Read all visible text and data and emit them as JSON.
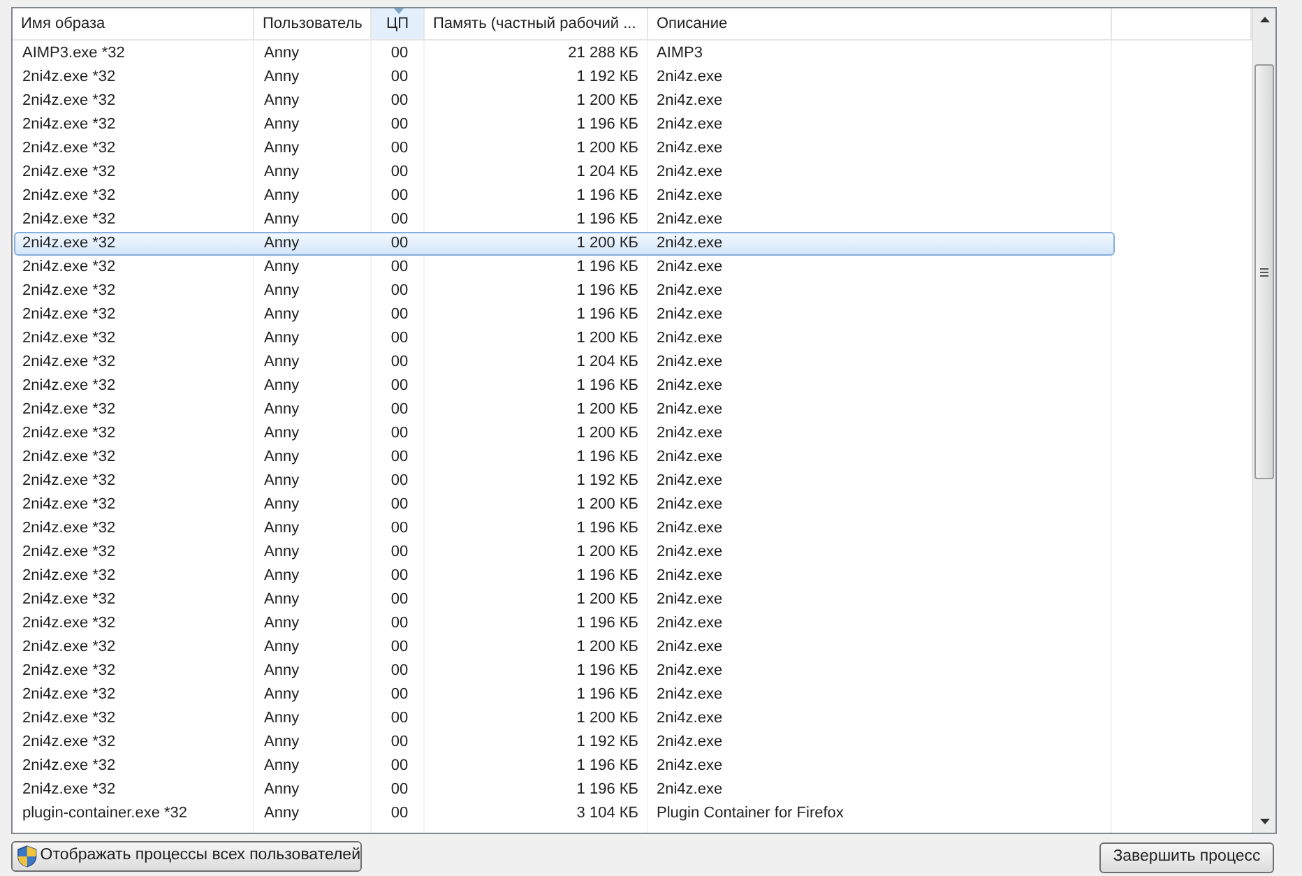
{
  "table": {
    "columns": [
      {
        "label": "Имя образа",
        "sorted": false
      },
      {
        "label": "Пользователь",
        "sorted": false
      },
      {
        "label": "ЦП",
        "sorted": true
      },
      {
        "label": "Память (частный рабочий ...",
        "sorted": false
      },
      {
        "label": "Описание",
        "sorted": false
      }
    ],
    "rows": [
      {
        "name": "AIMP3.exe *32",
        "user": "Anny",
        "cpu": "00",
        "memory": "21 288 КБ",
        "description": "AIMP3",
        "selected": false
      },
      {
        "name": "2ni4z.exe *32",
        "user": "Anny",
        "cpu": "00",
        "memory": "1 192 КБ",
        "description": "2ni4z.exe",
        "selected": false
      },
      {
        "name": "2ni4z.exe *32",
        "user": "Anny",
        "cpu": "00",
        "memory": "1 200 КБ",
        "description": "2ni4z.exe",
        "selected": false
      },
      {
        "name": "2ni4z.exe *32",
        "user": "Anny",
        "cpu": "00",
        "memory": "1 196 КБ",
        "description": "2ni4z.exe",
        "selected": false
      },
      {
        "name": "2ni4z.exe *32",
        "user": "Anny",
        "cpu": "00",
        "memory": "1 200 КБ",
        "description": "2ni4z.exe",
        "selected": false
      },
      {
        "name": "2ni4z.exe *32",
        "user": "Anny",
        "cpu": "00",
        "memory": "1 204 КБ",
        "description": "2ni4z.exe",
        "selected": false
      },
      {
        "name": "2ni4z.exe *32",
        "user": "Anny",
        "cpu": "00",
        "memory": "1 196 КБ",
        "description": "2ni4z.exe",
        "selected": false
      },
      {
        "name": "2ni4z.exe *32",
        "user": "Anny",
        "cpu": "00",
        "memory": "1 196 КБ",
        "description": "2ni4z.exe",
        "selected": false
      },
      {
        "name": "2ni4z.exe *32",
        "user": "Anny",
        "cpu": "00",
        "memory": "1 200 КБ",
        "description": "2ni4z.exe",
        "selected": true
      },
      {
        "name": "2ni4z.exe *32",
        "user": "Anny",
        "cpu": "00",
        "memory": "1 196 КБ",
        "description": "2ni4z.exe",
        "selected": false
      },
      {
        "name": "2ni4z.exe *32",
        "user": "Anny",
        "cpu": "00",
        "memory": "1 196 КБ",
        "description": "2ni4z.exe",
        "selected": false
      },
      {
        "name": "2ni4z.exe *32",
        "user": "Anny",
        "cpu": "00",
        "memory": "1 196 КБ",
        "description": "2ni4z.exe",
        "selected": false
      },
      {
        "name": "2ni4z.exe *32",
        "user": "Anny",
        "cpu": "00",
        "memory": "1 200 КБ",
        "description": "2ni4z.exe",
        "selected": false
      },
      {
        "name": "2ni4z.exe *32",
        "user": "Anny",
        "cpu": "00",
        "memory": "1 204 КБ",
        "description": "2ni4z.exe",
        "selected": false
      },
      {
        "name": "2ni4z.exe *32",
        "user": "Anny",
        "cpu": "00",
        "memory": "1 196 КБ",
        "description": "2ni4z.exe",
        "selected": false
      },
      {
        "name": "2ni4z.exe *32",
        "user": "Anny",
        "cpu": "00",
        "memory": "1 200 КБ",
        "description": "2ni4z.exe",
        "selected": false
      },
      {
        "name": "2ni4z.exe *32",
        "user": "Anny",
        "cpu": "00",
        "memory": "1 200 КБ",
        "description": "2ni4z.exe",
        "selected": false
      },
      {
        "name": "2ni4z.exe *32",
        "user": "Anny",
        "cpu": "00",
        "memory": "1 196 КБ",
        "description": "2ni4z.exe",
        "selected": false
      },
      {
        "name": "2ni4z.exe *32",
        "user": "Anny",
        "cpu": "00",
        "memory": "1 192 КБ",
        "description": "2ni4z.exe",
        "selected": false
      },
      {
        "name": "2ni4z.exe *32",
        "user": "Anny",
        "cpu": "00",
        "memory": "1 200 КБ",
        "description": "2ni4z.exe",
        "selected": false
      },
      {
        "name": "2ni4z.exe *32",
        "user": "Anny",
        "cpu": "00",
        "memory": "1 196 КБ",
        "description": "2ni4z.exe",
        "selected": false
      },
      {
        "name": "2ni4z.exe *32",
        "user": "Anny",
        "cpu": "00",
        "memory": "1 200 КБ",
        "description": "2ni4z.exe",
        "selected": false
      },
      {
        "name": "2ni4z.exe *32",
        "user": "Anny",
        "cpu": "00",
        "memory": "1 196 КБ",
        "description": "2ni4z.exe",
        "selected": false
      },
      {
        "name": "2ni4z.exe *32",
        "user": "Anny",
        "cpu": "00",
        "memory": "1 200 КБ",
        "description": "2ni4z.exe",
        "selected": false
      },
      {
        "name": "2ni4z.exe *32",
        "user": "Anny",
        "cpu": "00",
        "memory": "1 196 КБ",
        "description": "2ni4z.exe",
        "selected": false
      },
      {
        "name": "2ni4z.exe *32",
        "user": "Anny",
        "cpu": "00",
        "memory": "1 200 КБ",
        "description": "2ni4z.exe",
        "selected": false
      },
      {
        "name": "2ni4z.exe *32",
        "user": "Anny",
        "cpu": "00",
        "memory": "1 196 КБ",
        "description": "2ni4z.exe",
        "selected": false
      },
      {
        "name": "2ni4z.exe *32",
        "user": "Anny",
        "cpu": "00",
        "memory": "1 196 КБ",
        "description": "2ni4z.exe",
        "selected": false
      },
      {
        "name": "2ni4z.exe *32",
        "user": "Anny",
        "cpu": "00",
        "memory": "1 200 КБ",
        "description": "2ni4z.exe",
        "selected": false
      },
      {
        "name": "2ni4z.exe *32",
        "user": "Anny",
        "cpu": "00",
        "memory": "1 192 КБ",
        "description": "2ni4z.exe",
        "selected": false
      },
      {
        "name": "2ni4z.exe *32",
        "user": "Anny",
        "cpu": "00",
        "memory": "1 196 КБ",
        "description": "2ni4z.exe",
        "selected": false
      },
      {
        "name": "2ni4z.exe *32",
        "user": "Anny",
        "cpu": "00",
        "memory": "1 196 КБ",
        "description": "2ni4z.exe",
        "selected": false
      },
      {
        "name": "plugin-container.exe *32",
        "user": "Anny",
        "cpu": "00",
        "memory": "3 104 КБ",
        "description": "Plugin Container for Firefox",
        "selected": false
      }
    ]
  },
  "buttons": {
    "show_all": "Отображать процессы всех пользователей",
    "end_process": "Завершить процесс"
  }
}
